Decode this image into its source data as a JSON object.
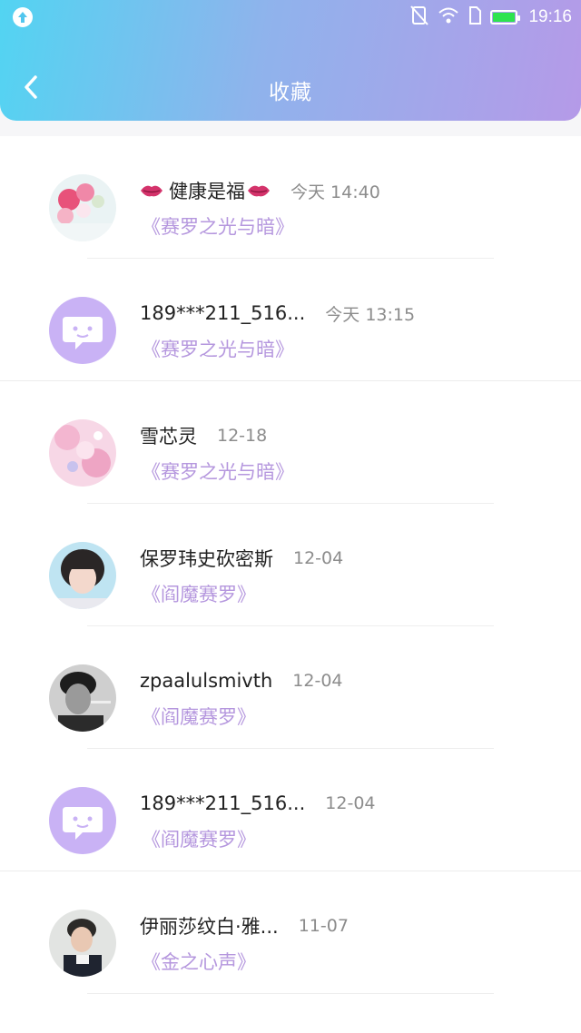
{
  "status_bar": {
    "time": "19:16",
    "icons": [
      "upload-icon",
      "no-sim-icon",
      "wifi-icon",
      "sim-card-icon",
      "battery-icon"
    ],
    "battery_color": "#2ee34f"
  },
  "header": {
    "title": "收藏",
    "back_icon": "chevron-left-icon",
    "gradient": [
      "#52d4f2",
      "#b59ae8"
    ]
  },
  "colors": {
    "work_title": "#b597de",
    "default_avatar": "#c9b2f5"
  },
  "favorites": [
    {
      "name": "健康是福",
      "name_decoration": "lips-emoji",
      "time": "今天 14:40",
      "work": "《赛罗之光与暗》",
      "avatar": "roses-photo"
    },
    {
      "name": "189***211_516...",
      "time": "今天 13:15",
      "work": "《赛罗之光与暗》",
      "avatar": "default-chat-avatar"
    },
    {
      "name": "雪芯灵",
      "time": "12-18",
      "work": "《赛罗之光与暗》",
      "avatar": "pink-anime-photo"
    },
    {
      "name": "保罗玮史砍密斯",
      "time": "12-04",
      "work": "《阎魔赛罗》",
      "avatar": "girl-photo"
    },
    {
      "name": "zpaalulsmivth",
      "time": "12-04",
      "work": "《阎魔赛罗》",
      "avatar": "bw-man-photo"
    },
    {
      "name": "189***211_516...",
      "time": "12-04",
      "work": "《阎魔赛罗》",
      "avatar": "default-chat-avatar"
    },
    {
      "name": "伊丽莎纹白·雅...",
      "time": "11-07",
      "work": "《金之心声》",
      "avatar": "boy-photo"
    }
  ]
}
